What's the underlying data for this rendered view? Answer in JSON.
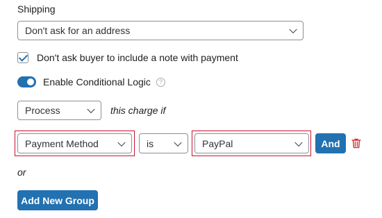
{
  "shipping": {
    "label": "Shipping",
    "selected": "Don't ask for an address"
  },
  "note_option": {
    "checked": true,
    "label": "Don't ask buyer to include a note with payment"
  },
  "conditional_logic": {
    "enabled": true,
    "label": "Enable Conditional Logic",
    "help_glyph": "?"
  },
  "rule": {
    "action_selected": "Process",
    "suffix_text": "this charge if",
    "field_selected": "Payment Method",
    "operator_selected": "is",
    "value_selected": "PayPal",
    "and_label": "And",
    "highlight_color": "#c8102e"
  },
  "or_text": "or",
  "add_group_label": "Add New Group",
  "colors": {
    "accent": "#2271b1",
    "delete": "#d63638"
  }
}
